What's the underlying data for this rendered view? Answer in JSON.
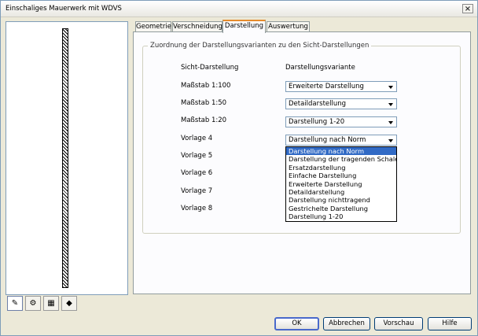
{
  "window": {
    "title": "Einschaliges Mauerwerk mit WDVS",
    "close_glyph": "×"
  },
  "preview": {
    "label": ""
  },
  "bottom_icons": [
    {
      "name": "pencil-icon",
      "glyph": "✎"
    },
    {
      "name": "gears-icon",
      "glyph": "⚙"
    },
    {
      "name": "table-icon",
      "glyph": "▦"
    },
    {
      "name": "tag-icon",
      "glyph": "◆"
    }
  ],
  "tabs": [
    "Geometrie",
    "Verschneidung",
    "Darstellung",
    "Auswertung"
  ],
  "selected_tab": "Darstellung",
  "group": {
    "legend": "Zuordnung der Darstellungsvarianten zu den Sicht-Darstellungen",
    "col1_header": "Sicht-Darstellung",
    "col2_header": "Darstellungsvariante",
    "rows": [
      {
        "label": "Maßstab 1:100",
        "value": "Erweiterte Darstellung"
      },
      {
        "label": "Maßstab 1:50",
        "value": "Detaildarstellung"
      },
      {
        "label": "Maßstab 1:20",
        "value": "Darstellung 1-20"
      },
      {
        "label": "Vorlage 4",
        "value": "Darstellung nach Norm"
      },
      {
        "label": "Vorlage 5"
      },
      {
        "label": "Vorlage 6"
      },
      {
        "label": "Vorlage 7"
      },
      {
        "label": "Vorlage 8"
      }
    ]
  },
  "dropdown_options": [
    "Darstellung nach Norm",
    "Darstellung der tragenden Schalen",
    "Ersatzdarstellung",
    "Einfache Darstellung",
    "Erweiterte Darstellung",
    "Detaildarstellung",
    "Darstellung nichttragend",
    "Gestrichelte Darstellung",
    "Darstellung 1-20"
  ],
  "buttons": {
    "ok": "OK",
    "cancel": "Abbrechen",
    "preview": "Vorschau",
    "help": "Hilfe"
  }
}
